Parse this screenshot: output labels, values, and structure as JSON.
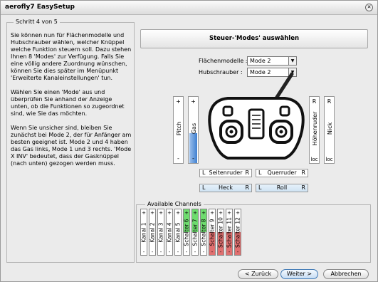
{
  "window": {
    "title": "aerofly7 EasySetup"
  },
  "step": {
    "legend": "Schritt 4 von 5"
  },
  "description": [
    "Sie können nun für Flächenmodelle und Hubschrauber wählen, welcher Knüppel welche Funktion steuern soll. Dazu stehen Ihnen 8 'Modes' zur Verfügung. Falls Sie eine völlig andere Zuordnung wünschen, können Sie dies später im Menüpunkt 'Erweiterte Kanaleinstellungen' tun.",
    "Wählen Sie einen 'Mode' aus und überprüfen Sie anhand der Anzeige unten, ob die Funktionen so zugeordnet sind, wie Sie das möchten.",
    "Wenn Sie unsicher sind, bleiben Sie zunächst bei Mode 2, der für Anfänger am besten geeignet ist. Mode 2 und 4 haben das Gas links, Mode 1 und 3 rechts. 'Mode X INV' bedeutet, dass der Gasknüppel (nach unten) gezogen werden muss."
  ],
  "mode_button": "Steuer-'Modes' auswählen",
  "selects": {
    "flaeche_label": "Flächenmodelle :",
    "flaeche_value": "Mode 2",
    "heli_label": "Hubschrauber :",
    "heli_value": "Mode 2",
    "arrow": "▼"
  },
  "sticks": {
    "pitch": {
      "label": "Pitch",
      "plus": "+",
      "minus": "-"
    },
    "gas": {
      "label": "Gas",
      "plus": "+",
      "minus": "-",
      "level": 0.45
    },
    "hoehenruder": {
      "label": "Höhenruder",
      "top": "R",
      "bottom": "loc"
    },
    "nick": {
      "label": "Nick",
      "top": "R",
      "bottom": "loc"
    },
    "seitenruder": {
      "label": "Seitenruder",
      "left": "L",
      "right": "R"
    },
    "querruder": {
      "label": "Querruder",
      "left": "L",
      "right": "R"
    },
    "heck": {
      "label": "Heck",
      "left": "L",
      "right": "R"
    },
    "roll": {
      "label": "Roll",
      "left": "L",
      "right": "R"
    }
  },
  "available_channels": {
    "legend": "Available Channels",
    "plus": "+",
    "minus": "-",
    "channels": [
      {
        "label": "Kanal 1",
        "state": "none"
      },
      {
        "label": "Kanal 2",
        "state": "none"
      },
      {
        "label": "Kanal 3",
        "state": "none"
      },
      {
        "label": "Kanal 4",
        "state": "none"
      },
      {
        "label": "Kanal 5",
        "state": "none"
      },
      {
        "label": "Schalter 6",
        "state": "plus"
      },
      {
        "label": "Schalter 7",
        "state": "plus"
      },
      {
        "label": "Schalter 8",
        "state": "plus"
      },
      {
        "label": "Schalter 9",
        "state": "minus"
      },
      {
        "label": "Schalter 10",
        "state": "minus"
      },
      {
        "label": "Schalter 11",
        "state": "minus"
      },
      {
        "label": "Schalter 12",
        "state": "minus"
      }
    ]
  },
  "colors": {
    "green": "#6edc6e",
    "red": "#e07070",
    "blue": "#3f7fd0"
  },
  "buttons": {
    "back": "< Zurück",
    "next": "Weiter >",
    "cancel": "Abbrechen"
  }
}
